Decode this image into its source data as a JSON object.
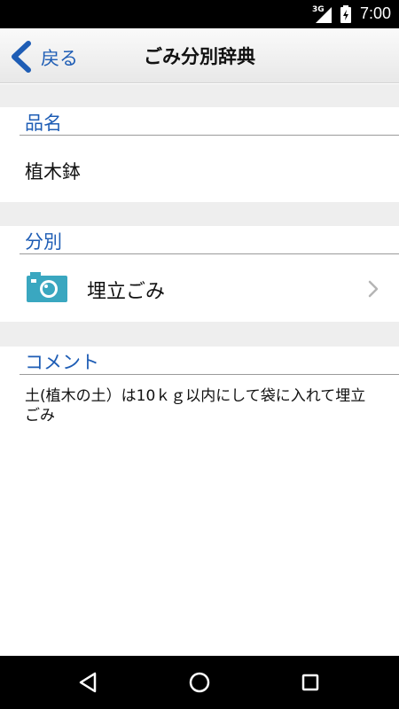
{
  "status_bar": {
    "network": "3G",
    "time": "7:00",
    "icons": [
      "signal-icon",
      "battery-charging-icon"
    ]
  },
  "app_bar": {
    "back_label": "戻る",
    "title": "ごみ分別辞典"
  },
  "item_section": {
    "header": "品名",
    "value": "植木鉢"
  },
  "category_section": {
    "header": "分別",
    "category": "埋立ごみ",
    "icon": "camera-icon"
  },
  "comment_section": {
    "header": "コメント",
    "text": "土(植木の土）は10ｋｇ以内にして袋に入れて埋立ごみ"
  },
  "nav_bar": {
    "icons": [
      "back-triangle-icon",
      "home-circle-icon",
      "recents-square-icon"
    ]
  },
  "colors": {
    "accent": "#1e5db5",
    "camera": "#3aa7c0",
    "gap": "#eeeeee"
  }
}
